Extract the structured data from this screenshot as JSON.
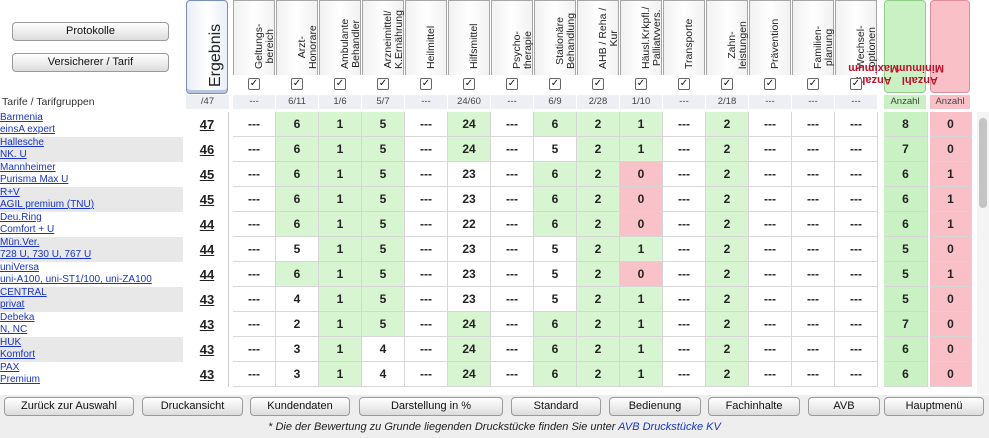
{
  "top_buttons": {
    "protokolle": "Protokolle",
    "versicherer": "Versicherer / Tarif"
  },
  "ergebnis": "Ergebnis",
  "columns": [
    {
      "label": "Geltungs-\nbereich",
      "count": "---"
    },
    {
      "label": "Arzt-\nHonorare",
      "count": "6/11"
    },
    {
      "label": "Ambulante\nBehandler",
      "count": "1/6"
    },
    {
      "label": "Arzneimittel/\nK.Ernährung",
      "count": "5/7"
    },
    {
      "label": "Heilmittel",
      "count": "---"
    },
    {
      "label": "Hilfsmittel",
      "count": "24/60"
    },
    {
      "label": "Psycho-\ntherapie",
      "count": "---"
    },
    {
      "label": "Stationäre\nBehandlung",
      "count": "6/9"
    },
    {
      "label": "AHB / Reha /\nKur",
      "count": "2/28"
    },
    {
      "label": "Häusl.Krkpfl./\nPalliatvvers.",
      "count": "1/10"
    },
    {
      "label": "Transporte",
      "count": "---"
    },
    {
      "label": "Zahn-\nleistungen",
      "count": "2/18"
    },
    {
      "label": "Prävention",
      "count": "---"
    },
    {
      "label": "Familien-\nplanung",
      "count": "---"
    },
    {
      "label": "Wechsel-\noptionen",
      "count": "---"
    }
  ],
  "sum_columns": {
    "max_label": "Anzahl\nMaximum",
    "min_label": "Anzahl\nMinimum",
    "max_sub": "Anzahl",
    "min_sub": "Anzahl"
  },
  "subheader": {
    "tarife_label": "Tarife / Tarifgruppen",
    "ergebnis_count": "/47"
  },
  "rows": [
    {
      "insurer": "Barmenia",
      "tarif": "einsA expert",
      "score": "47",
      "values": [
        "---",
        "6",
        "1",
        "5",
        "---",
        "24",
        "---",
        "6",
        "2",
        "1",
        "---",
        "2",
        "---",
        "---",
        "---"
      ],
      "max": "8",
      "min": "0"
    },
    {
      "insurer": "Hallesche",
      "tarif": "NK. U",
      "score": "46",
      "values": [
        "---",
        "6",
        "1",
        "5",
        "---",
        "24",
        "---",
        "5",
        "2",
        "1",
        "---",
        "2",
        "---",
        "---",
        "---"
      ],
      "max": "7",
      "min": "0"
    },
    {
      "insurer": "Mannheimer",
      "tarif": "Purisma Max U",
      "score": "45",
      "values": [
        "---",
        "6",
        "1",
        "5",
        "---",
        "23",
        "---",
        "6",
        "2",
        "0",
        "---",
        "2",
        "---",
        "---",
        "---"
      ],
      "max": "6",
      "min": "1"
    },
    {
      "insurer": "R+V",
      "tarif": "AGIL premium (TNU)",
      "score": "45",
      "values": [
        "---",
        "6",
        "1",
        "5",
        "---",
        "23",
        "---",
        "6",
        "2",
        "0",
        "---",
        "2",
        "---",
        "---",
        "---"
      ],
      "max": "6",
      "min": "1"
    },
    {
      "insurer": "Deu.Ring",
      "tarif": "Comfort + U",
      "score": "44",
      "values": [
        "---",
        "6",
        "1",
        "5",
        "---",
        "22",
        "---",
        "6",
        "2",
        "0",
        "---",
        "2",
        "---",
        "---",
        "---"
      ],
      "max": "6",
      "min": "1"
    },
    {
      "insurer": "Mün.Ver.",
      "tarif": "728 U, 730 U, 767 U",
      "score": "44",
      "values": [
        "---",
        "5",
        "1",
        "5",
        "---",
        "23",
        "---",
        "5",
        "2",
        "1",
        "---",
        "2",
        "---",
        "---",
        "---"
      ],
      "max": "5",
      "min": "0"
    },
    {
      "insurer": "uniVersa",
      "tarif": "uni-A100, uni-ST1/100, uni-ZA100",
      "score": "44",
      "values": [
        "---",
        "6",
        "1",
        "5",
        "---",
        "23",
        "---",
        "5",
        "2",
        "0",
        "---",
        "2",
        "---",
        "---",
        "---"
      ],
      "max": "5",
      "min": "1"
    },
    {
      "insurer": "CENTRAL",
      "tarif": "privat",
      "score": "43",
      "values": [
        "---",
        "4",
        "1",
        "5",
        "---",
        "23",
        "---",
        "5",
        "2",
        "1",
        "---",
        "2",
        "---",
        "---",
        "---"
      ],
      "max": "5",
      "min": "0"
    },
    {
      "insurer": "Debeka",
      "tarif": "N, NC",
      "score": "43",
      "values": [
        "---",
        "2",
        "1",
        "5",
        "---",
        "24",
        "---",
        "6",
        "2",
        "1",
        "---",
        "2",
        "---",
        "---",
        "---"
      ],
      "max": "7",
      "min": "0"
    },
    {
      "insurer": "HUK",
      "tarif": "Komfort",
      "score": "43",
      "values": [
        "---",
        "3",
        "1",
        "4",
        "---",
        "24",
        "---",
        "6",
        "2",
        "1",
        "---",
        "2",
        "---",
        "---",
        "---"
      ],
      "max": "6",
      "min": "0"
    },
    {
      "insurer": "PAX",
      "tarif": "Premium",
      "score": "43",
      "values": [
        "---",
        "3",
        "1",
        "4",
        "---",
        "24",
        "---",
        "6",
        "2",
        "1",
        "---",
        "2",
        "---",
        "---",
        "---"
      ],
      "max": "6",
      "min": "0"
    }
  ],
  "row_colors": [
    [
      "w",
      "g",
      "g",
      "g",
      "w",
      "g",
      "w",
      "g",
      "g",
      "g",
      "w",
      "g",
      "w",
      "w",
      "w"
    ],
    [
      "w",
      "g",
      "g",
      "g",
      "w",
      "g",
      "w",
      "w",
      "g",
      "g",
      "w",
      "g",
      "w",
      "w",
      "w"
    ],
    [
      "w",
      "g",
      "g",
      "g",
      "w",
      "w",
      "w",
      "g",
      "g",
      "r",
      "w",
      "g",
      "w",
      "w",
      "w"
    ],
    [
      "w",
      "g",
      "g",
      "g",
      "w",
      "w",
      "w",
      "g",
      "g",
      "r",
      "w",
      "g",
      "w",
      "w",
      "w"
    ],
    [
      "w",
      "g",
      "g",
      "g",
      "w",
      "w",
      "w",
      "g",
      "g",
      "r",
      "w",
      "g",
      "w",
      "w",
      "w"
    ],
    [
      "w",
      "w",
      "g",
      "g",
      "w",
      "w",
      "w",
      "w",
      "g",
      "g",
      "w",
      "g",
      "w",
      "w",
      "w"
    ],
    [
      "w",
      "g",
      "g",
      "g",
      "w",
      "w",
      "w",
      "w",
      "g",
      "r",
      "w",
      "g",
      "w",
      "w",
      "w"
    ],
    [
      "w",
      "w",
      "g",
      "g",
      "w",
      "w",
      "w",
      "w",
      "g",
      "g",
      "w",
      "g",
      "w",
      "w",
      "w"
    ],
    [
      "w",
      "w",
      "g",
      "g",
      "w",
      "g",
      "w",
      "g",
      "g",
      "g",
      "w",
      "g",
      "w",
      "w",
      "w"
    ],
    [
      "w",
      "w",
      "g",
      "w",
      "w",
      "g",
      "w",
      "g",
      "g",
      "g",
      "w",
      "g",
      "w",
      "w",
      "w"
    ],
    [
      "w",
      "w",
      "g",
      "w",
      "w",
      "g",
      "w",
      "g",
      "g",
      "g",
      "w",
      "g",
      "w",
      "w",
      "w"
    ]
  ],
  "bottom_buttons": [
    "Zurück zur Auswahl",
    "Druckansicht",
    "Kundendaten",
    "Darstellung in %",
    "Standard",
    "Bedienung",
    "Fachinhalte",
    "AVB",
    "Hauptmenü"
  ],
  "footer": {
    "text": "* Die der Bewertung zu Grunde liegenden Druckstücke finden Sie unter ",
    "link": "AVB Druckstücke KV"
  },
  "colors": {
    "green": "#d8f5d2",
    "red": "#f9c2c8",
    "link": "#1a35c4"
  }
}
